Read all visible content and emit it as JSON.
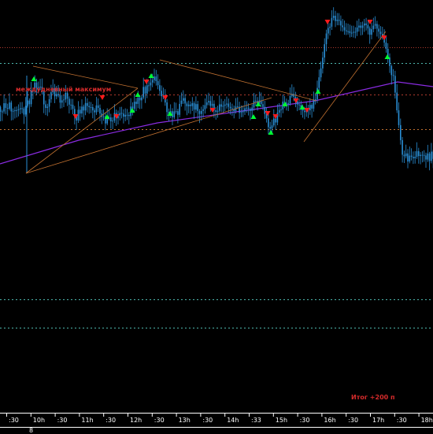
{
  "colors": {
    "background": "#000000",
    "candle": "#2a8fd6",
    "ma": "#8a2be2",
    "trendline": "#c07030",
    "level_red": "#b03a2e",
    "level_teal": "#4db6ac",
    "level_orange": "#c07030",
    "annotation_red": "#d52b2b",
    "up_arrow": "#00ff33",
    "down_arrow": "#ff1a1a",
    "axis": "#ffffff"
  },
  "annotations": {
    "daily_high_label": "междудневный максимум",
    "result_label": "Итог +200 п"
  },
  "chart_data": {
    "type": "line",
    "title": "",
    "xlabel": "",
    "ylabel": "",
    "x_ticks": [
      ":30",
      "10h",
      ":30",
      "11h",
      ":30",
      "12h",
      ":30",
      "13h",
      ":30",
      "14h",
      ":33",
      "15h",
      ":30",
      "16h",
      ":30",
      "17h",
      ":30",
      "18h"
    ],
    "x_sub_label": "8",
    "series": [
      {
        "price_path": [
          [
            0,
            72
          ],
          [
            16,
            72
          ],
          [
            32,
            70
          ],
          [
            38,
            78
          ],
          [
            42,
            87
          ],
          [
            50,
            84
          ],
          [
            58,
            72
          ],
          [
            66,
            82
          ],
          [
            76,
            75
          ],
          [
            84,
            80
          ],
          [
            96,
            66
          ],
          [
            108,
            74
          ],
          [
            116,
            72
          ],
          [
            126,
            70
          ],
          [
            134,
            62
          ],
          [
            142,
            65
          ],
          [
            152,
            68
          ],
          [
            160,
            66
          ],
          [
            168,
            72
          ],
          [
            176,
            78
          ],
          [
            186,
            85
          ],
          [
            196,
            90
          ],
          [
            204,
            80
          ],
          [
            212,
            70
          ],
          [
            222,
            66
          ],
          [
            232,
            76
          ],
          [
            244,
            74
          ],
          [
            254,
            70
          ],
          [
            264,
            74
          ],
          [
            276,
            70
          ],
          [
            284,
            74
          ],
          [
            296,
            71
          ],
          [
            306,
            68
          ],
          [
            316,
            72
          ],
          [
            326,
            76
          ],
          [
            334,
            70
          ],
          [
            342,
            58
          ],
          [
            350,
            64
          ],
          [
            358,
            74
          ],
          [
            366,
            76
          ],
          [
            372,
            78
          ],
          [
            378,
            74
          ],
          [
            386,
            70
          ],
          [
            392,
            72
          ],
          [
            400,
            76
          ],
          [
            408,
            98
          ],
          [
            414,
            120
          ],
          [
            422,
            128
          ],
          [
            430,
            126
          ],
          [
            438,
            119
          ],
          [
            446,
            118
          ],
          [
            454,
            122
          ],
          [
            462,
            126
          ],
          [
            470,
            120
          ],
          [
            478,
            124
          ],
          [
            486,
            115
          ],
          [
            494,
            100
          ],
          [
            500,
            90
          ],
          [
            504,
            66
          ],
          [
            510,
            44
          ],
          [
            518,
            38
          ],
          [
            526,
            40
          ],
          [
            534,
            44
          ],
          [
            542,
            40
          ],
          [
            550,
            42
          ]
        ]
      }
    ],
    "ma_path": [
      [
        0,
        36
      ],
      [
        100,
        51
      ],
      [
        200,
        62
      ],
      [
        300,
        69
      ],
      [
        400,
        76
      ],
      [
        505,
        88
      ],
      [
        550,
        85
      ]
    ],
    "levels": [
      {
        "y": 110,
        "style": "dotted",
        "color": "red"
      },
      {
        "y": 100,
        "style": "dashed",
        "color": "teal"
      },
      {
        "y": 80,
        "style": "dashed",
        "color": "red"
      },
      {
        "y": 58,
        "style": "dashed",
        "color": "orange"
      },
      {
        "y": -50,
        "style": "dashed",
        "color": "teal"
      },
      {
        "y": -68,
        "style": "dashed",
        "color": "teal"
      }
    ],
    "trendlines": [
      {
        "from": [
          33,
          30
        ],
        "to": [
          175,
          84
        ]
      },
      {
        "from": [
          33,
          30
        ],
        "to": [
          345,
          78
        ]
      },
      {
        "from": [
          42,
          98
        ],
        "to": [
          175,
          84
        ]
      },
      {
        "from": [
          203,
          102
        ],
        "to": [
          402,
          76
        ]
      },
      {
        "from": [
          386,
          50
        ],
        "to": [
          490,
          120
        ]
      }
    ],
    "signals": [
      {
        "x": 43,
        "y": 90,
        "dir": "up"
      },
      {
        "x": 96,
        "y": 66,
        "dir": "down"
      },
      {
        "x": 130,
        "y": 78,
        "dir": "down"
      },
      {
        "x": 136,
        "y": 66,
        "dir": "up"
      },
      {
        "x": 148,
        "y": 66,
        "dir": "down"
      },
      {
        "x": 168,
        "y": 70,
        "dir": "up"
      },
      {
        "x": 175,
        "y": 80,
        "dir": "up"
      },
      {
        "x": 186,
        "y": 88,
        "dir": "down"
      },
      {
        "x": 192,
        "y": 92,
        "dir": "up"
      },
      {
        "x": 210,
        "y": 78,
        "dir": "down"
      },
      {
        "x": 216,
        "y": 68,
        "dir": "up"
      },
      {
        "x": 270,
        "y": 70,
        "dir": "down"
      },
      {
        "x": 322,
        "y": 66,
        "dir": "up"
      },
      {
        "x": 328,
        "y": 74,
        "dir": "up"
      },
      {
        "x": 340,
        "y": 68,
        "dir": "down"
      },
      {
        "x": 350,
        "y": 66,
        "dir": "down"
      },
      {
        "x": 344,
        "y": 56,
        "dir": "up"
      },
      {
        "x": 362,
        "y": 74,
        "dir": "up"
      },
      {
        "x": 376,
        "y": 76,
        "dir": "down"
      },
      {
        "x": 384,
        "y": 72,
        "dir": "up"
      },
      {
        "x": 390,
        "y": 70,
        "dir": "down"
      },
      {
        "x": 404,
        "y": 82,
        "dir": "up"
      },
      {
        "x": 416,
        "y": 126,
        "dir": "down"
      },
      {
        "x": 470,
        "y": 126,
        "dir": "down"
      },
      {
        "x": 488,
        "y": 116,
        "dir": "down"
      },
      {
        "x": 492,
        "y": 104,
        "dir": "up"
      }
    ],
    "xlim": [
      0,
      550
    ],
    "ylim": [
      -120,
      140
    ]
  }
}
